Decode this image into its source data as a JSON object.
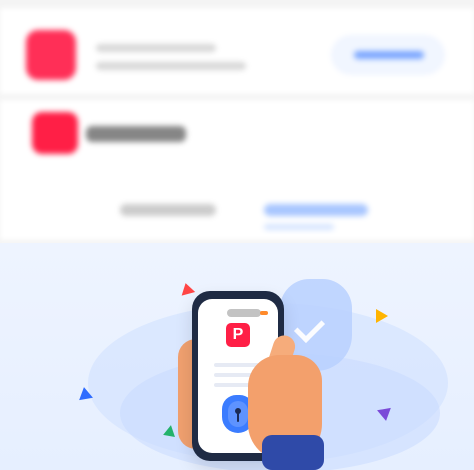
{
  "screenshot": {
    "top_section": {
      "buttons": [
        {
          "label": ""
        },
        {
          "label": ""
        }
      ]
    },
    "illustration": {
      "phone_app_icon": "paypay-logo-icon",
      "security_icon": "lock-shield-icon",
      "background_icon": "check-shield-icon",
      "decorations": [
        "triangle-red",
        "triangle-yellow",
        "triangle-blue",
        "triangle-green",
        "triangle-purple"
      ]
    },
    "colors": {
      "paypay_red": "#ff1f46",
      "illustration_bg": "#eef4ff",
      "shield_blue": "#3b7cff",
      "check_shield_blue": "#b8d0ff"
    }
  }
}
